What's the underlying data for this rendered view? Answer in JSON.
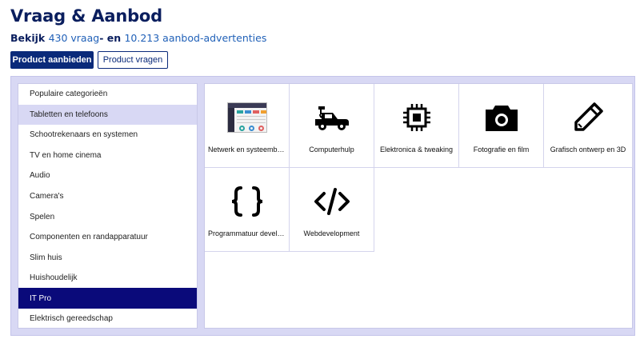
{
  "header": {
    "title": "Vraag & Aanbod",
    "subtitle_prefix": "Bekijk ",
    "vraag_count": "430 vraag",
    "subtitle_mid": "- en ",
    "aanbod_count": "10.213 aanbod-advertenties"
  },
  "actions": {
    "offer_label": "Product aanbieden",
    "request_label": "Product vragen"
  },
  "categories": [
    "Populaire categorieën",
    "Tabletten en telefoons",
    "Schootrekenaars en systemen",
    "TV en home cinema",
    "Audio",
    "Camera's",
    "Spelen",
    "Componenten en randapparatuur",
    "Slim huis",
    "Huishoudelijk",
    "IT Pro",
    "Elektrisch gereedschap"
  ],
  "active_category": "IT Pro",
  "hover_category": "Tabletten en telefoons",
  "subcategories": [
    {
      "label": "Netwerk en systeembeheer",
      "icon": "network-screenshot-icon"
    },
    {
      "label": "Computerhulp",
      "icon": "tow-truck-icon"
    },
    {
      "label": "Elektronica & tweaking",
      "icon": "chip-icon"
    },
    {
      "label": "Fotografie en film",
      "icon": "camera-icon"
    },
    {
      "label": "Grafisch ontwerp en 3D",
      "icon": "pencil-icon"
    },
    {
      "label": "Programmatuur development",
      "icon": "curly-braces-icon"
    },
    {
      "label": "Webdevelopment",
      "icon": "code-tag-icon"
    }
  ],
  "colors": {
    "brand": "#0a2a7a",
    "link": "#2161b8",
    "active": "#0a0a7a",
    "panel": "#d8d8f4"
  }
}
